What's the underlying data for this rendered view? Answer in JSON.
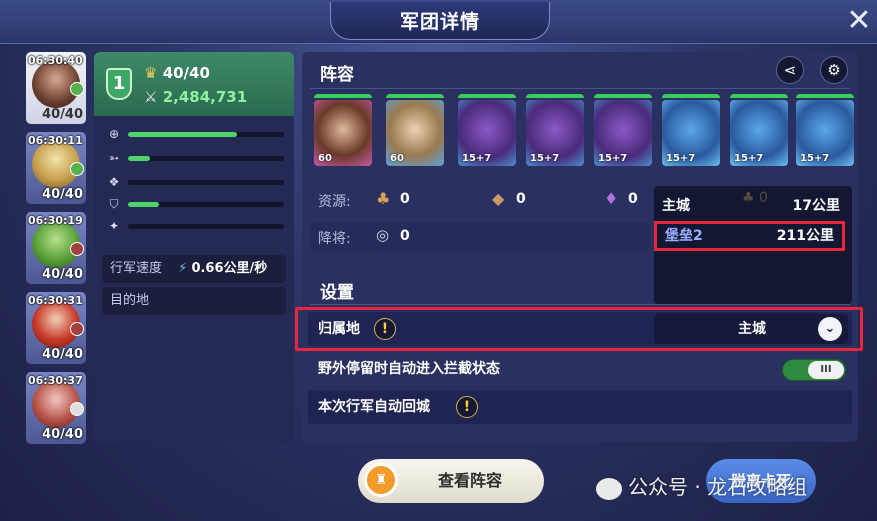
{
  "window": {
    "title": "军团详情",
    "close_label": "✕"
  },
  "troops": [
    {
      "time": "06:30:40",
      "count": "40/40"
    },
    {
      "time": "06:30:11",
      "count": "40/40"
    },
    {
      "time": "06:30:19",
      "count": "40/40"
    },
    {
      "time": "06:30:31",
      "count": "40/40"
    },
    {
      "time": "06:30:37",
      "count": "40/40"
    }
  ],
  "stats": {
    "level": "1",
    "capacity": "40/40",
    "power": "2,484,731",
    "bars": [
      {
        "icon": "attack-icon",
        "fraction": 0.7
      },
      {
        "icon": "speed-icon",
        "fraction": 0.14
      },
      {
        "icon": "wings-icon",
        "fraction": 0.0
      },
      {
        "icon": "defense-icon",
        "fraction": 0.2
      },
      {
        "icon": "magic-icon",
        "fraction": 0.0
      }
    ],
    "march_speed_label": "行军速度",
    "march_speed_value": "0.66公里/秒",
    "destination_label": "目的地"
  },
  "lineup": {
    "title": "阵容",
    "heroes": [
      {
        "level": "60",
        "kind": "hero"
      },
      {
        "level": "60",
        "kind": "hero"
      },
      {
        "level": "15+7",
        "kind": "dragon-purple"
      },
      {
        "level": "15+7",
        "kind": "dragon-purple"
      },
      {
        "level": "15+7",
        "kind": "dragon-purple"
      },
      {
        "level": "15+7",
        "kind": "dragon-blue"
      },
      {
        "level": "15+7",
        "kind": "dragon-blue"
      },
      {
        "level": "15+7",
        "kind": "dragon-blue"
      }
    ],
    "resources_label": "资源:",
    "resources": [
      "0",
      "0",
      "0"
    ],
    "surrender_label": "降将:",
    "surrender_value": "0"
  },
  "dropdown": {
    "options": [
      {
        "name": "主城",
        "distance": "17公里"
      },
      {
        "name": "堡垒2",
        "distance": "211公里"
      }
    ],
    "hidden_value": "0"
  },
  "settings": {
    "title": "设置",
    "home_label": "归属地",
    "home_value": "主城",
    "auto_intercept_label": "野外停留时自动进入拦截状态",
    "auto_return_label": "本次行军自动回城",
    "toggle_knob": "III",
    "warn_glyph": "!"
  },
  "bottom": {
    "view_lineup_label": "查看阵容",
    "leave_label": "脱离卡死",
    "watermark": "公众号 · 龙石攻略组"
  },
  "colors": {
    "accent_green": "#36d058",
    "highlight_red": "#e8253a",
    "stats_head": "#2a6a4e"
  }
}
